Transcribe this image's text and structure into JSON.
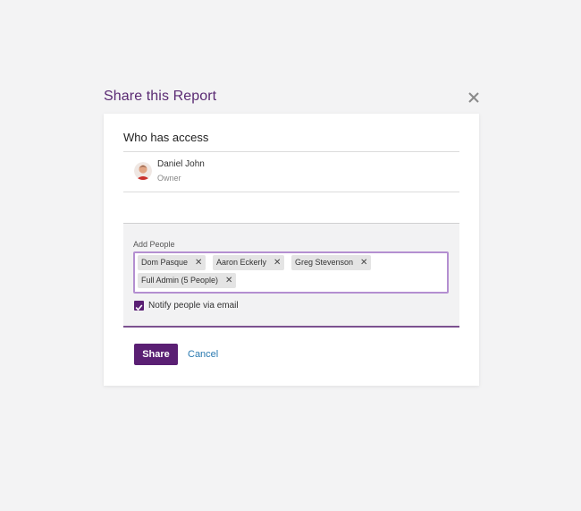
{
  "dialog": {
    "title": "Share this Report",
    "close_icon": "close-icon"
  },
  "access": {
    "heading": "Who has access",
    "owner": {
      "name": "Daniel John",
      "role": "Owner",
      "avatar_icon": "avatar"
    }
  },
  "add_people": {
    "label": "Add People",
    "tags": [
      {
        "label": "Dom Pasque",
        "remove_icon": "close-icon"
      },
      {
        "label": "Aaron Eckerly",
        "remove_icon": "close-icon"
      },
      {
        "label": "Greg Stevenson",
        "remove_icon": "close-icon"
      },
      {
        "label": "Full Admin (5 People)",
        "remove_icon": "close-icon"
      }
    ],
    "notify": {
      "label": "Notify people via email",
      "checked": true
    }
  },
  "actions": {
    "share_label": "Share",
    "cancel_label": "Cancel"
  },
  "colors": {
    "accent": "#5a1f73",
    "title": "#5a2a73",
    "link": "#2a7ab0",
    "input_focus": "#b48fd1"
  }
}
